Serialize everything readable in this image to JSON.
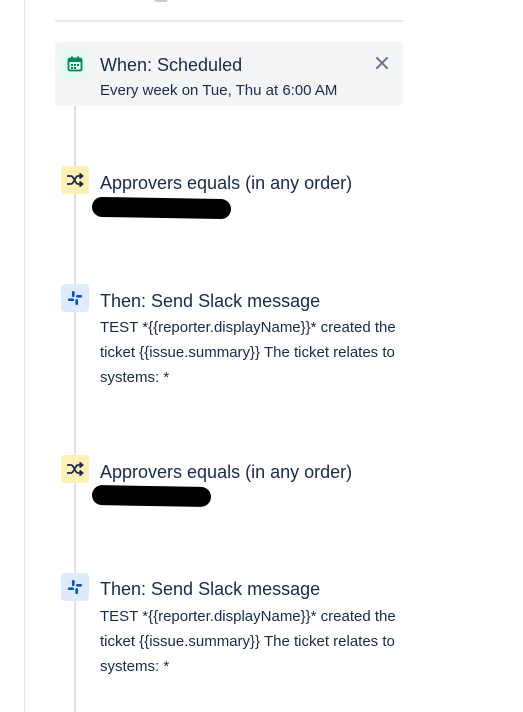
{
  "trigger": {
    "title": "When: Scheduled",
    "description": "Every week on Tue, Thu at 6:00 AM",
    "icon": "calendar-icon",
    "close_label": "×"
  },
  "steps": [
    {
      "type": "condition",
      "icon": "branch-shuffle-icon",
      "title": "Approvers equals (in any order)",
      "value_redacted": true
    },
    {
      "type": "action",
      "icon": "slack-icon",
      "title": "Then: Send Slack message",
      "description": "TEST *{{reporter.displayName}}* created the ticket {{issue.summary}} The ticket relates to systems: *"
    },
    {
      "type": "condition",
      "icon": "branch-shuffle-icon",
      "title": "Approvers equals (in any order)",
      "value_redacted": true
    },
    {
      "type": "action",
      "icon": "slack-icon",
      "title": "Then: Send Slack message",
      "description": "TEST *{{reporter.displayName}}* created the ticket {{issue.summary}} The ticket relates to systems: *"
    }
  ],
  "colors": {
    "text": "#172b4d",
    "trigger_bg": "#f4f5f7",
    "trigger_icon_bg": "#e3fcef",
    "trigger_icon": "#00875a",
    "condition_icon_bg": "#fff0b3",
    "condition_icon": "#172b4d",
    "action_icon_bg": "#deebff",
    "action_icon": "#0052cc",
    "timeline": "#dfe1e6"
  }
}
